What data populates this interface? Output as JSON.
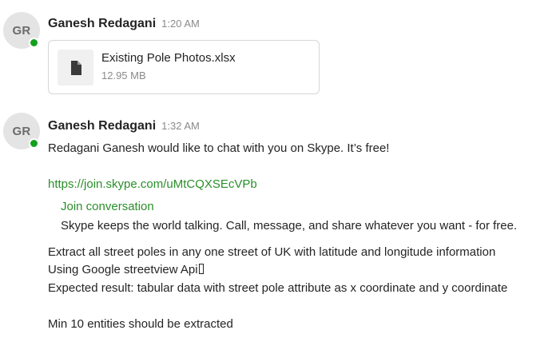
{
  "messages": [
    {
      "avatar_initials": "GR",
      "sender": "Ganesh Redagani",
      "time": "1:20 AM",
      "attachment": {
        "icon": "document-icon",
        "file_name": "Existing Pole Photos.xlsx",
        "file_size": "12.95 MB"
      }
    },
    {
      "avatar_initials": "GR",
      "sender": "Ganesh Redagani",
      "time": "1:32 AM",
      "intro": "Redagani Ganesh would like to chat with you on Skype. It’s free!",
      "link": "https://join.skype.com/uMtCQXSEcVPb",
      "preview": {
        "title": "Join conversation",
        "description": "Skype keeps the world talking. Call, message, and share whatever you want - for free."
      },
      "body_lines": [
        "Extract all street poles in any one street of UK with latitude and longitude information",
        "Using Google streetview Api",
        "Expected result: tabular data with street pole attribute as x coordinate and y coordinate",
        "Min 10 entities should be extracted"
      ]
    }
  ],
  "colors": {
    "presence": "#14a01f",
    "link": "#2a8f2a"
  }
}
